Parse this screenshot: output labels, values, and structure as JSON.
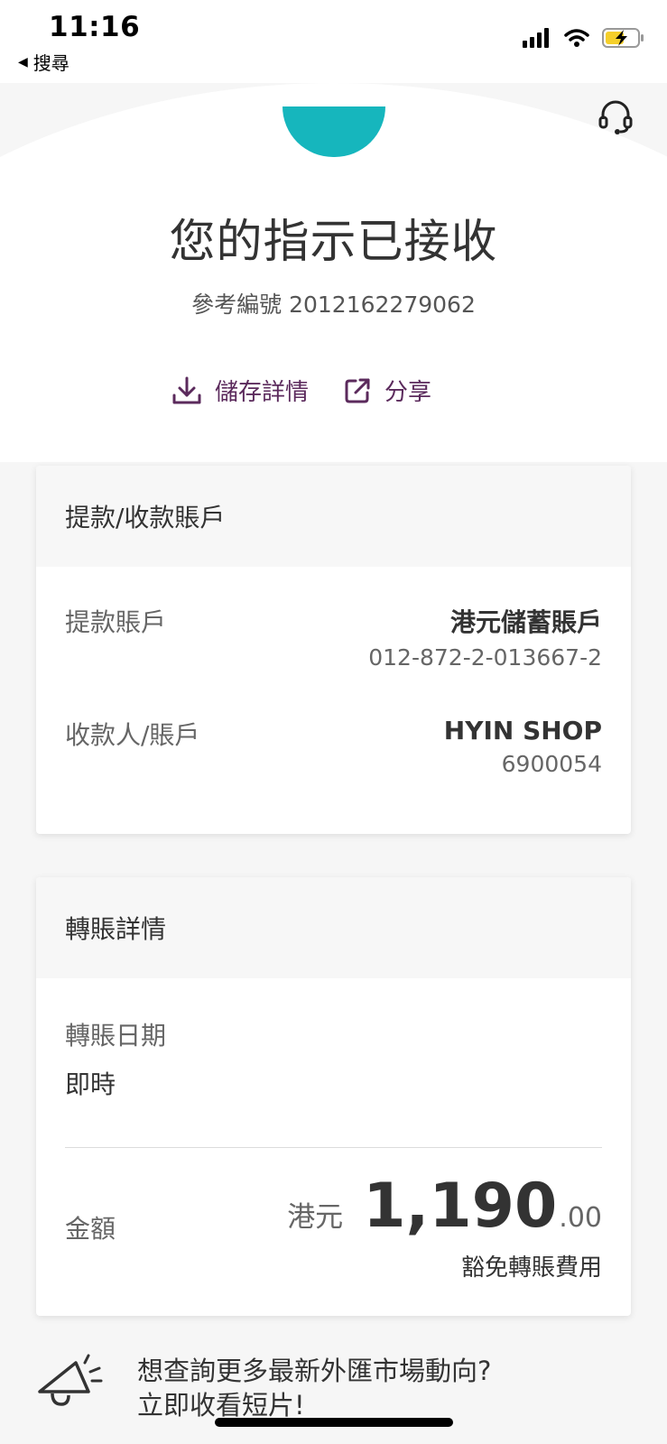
{
  "status_bar": {
    "time": "11:16",
    "back_label": "搜尋",
    "icons": [
      "signal-icon",
      "wifi-icon",
      "battery-charging-icon"
    ]
  },
  "header": {
    "support_icon": "headset-icon"
  },
  "confirmation": {
    "title": "您的指示已接收",
    "reference": "參考編號 2012162279062"
  },
  "actions": {
    "save_label": "儲存詳情",
    "share_label": "分享"
  },
  "accounts_card": {
    "header": "提款/收款賬戶",
    "debit_label": "提款賬戶",
    "debit_account_name": "港元儲蓄賬戶",
    "debit_account_number": "012-872-2-013667-2",
    "payee_label": "收款人/賬戶",
    "payee_name": "HYIN SHOP",
    "payee_account_number": "6900054"
  },
  "transfer_card": {
    "header": "轉賬詳情",
    "date_label": "轉賬日期",
    "date_value": "即時",
    "amount_label": "金額",
    "amount_currency": "港元",
    "amount_integer": "1,190",
    "amount_decimal": ".00",
    "fee_note": "豁免轉賬費用"
  },
  "promo": {
    "icon": "megaphone-icon",
    "line1": "想查詢更多最新外匯市場動向?",
    "line2": "立即收看短片!"
  },
  "colors": {
    "brand_purple": "#5b2a5c",
    "accent_teal": "#16b6bd",
    "page_bg": "#f6f6f6"
  }
}
